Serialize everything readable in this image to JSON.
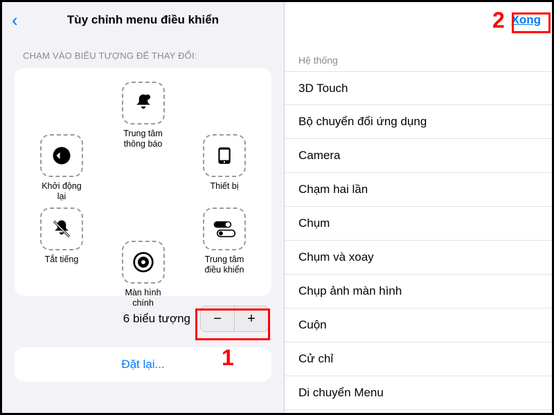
{
  "left": {
    "title": "Tùy chỉnh menu điều khiển",
    "section_label": "CHẠM VÀO BIỂU TƯỢNG ĐỂ THAY ĐỔI:",
    "slots": {
      "top": {
        "label": "Trung tâm thông báo"
      },
      "tl": {
        "label": "Khởi động lại"
      },
      "tr": {
        "label": "Thiết bị"
      },
      "bl": {
        "label": "Tắt tiếng"
      },
      "br": {
        "label": "Trung tâm điều khiển"
      },
      "bottom": {
        "label": "Màn hình chính"
      }
    },
    "stepper": {
      "label": "6 biểu tượng"
    },
    "reset_label": "Đặt lại..."
  },
  "right": {
    "done_label": "Xong",
    "section_label": "Hệ thống",
    "items": [
      "3D Touch",
      "Bộ chuyển đổi ứng dụng",
      "Camera",
      "Chạm hai lần",
      "Chụm",
      "Chụm và xoay",
      "Chụp ảnh màn hình",
      "Cuộn",
      "Cử chỉ",
      "Di chuyển Menu"
    ]
  },
  "annotations": {
    "one": "1",
    "two": "2"
  }
}
